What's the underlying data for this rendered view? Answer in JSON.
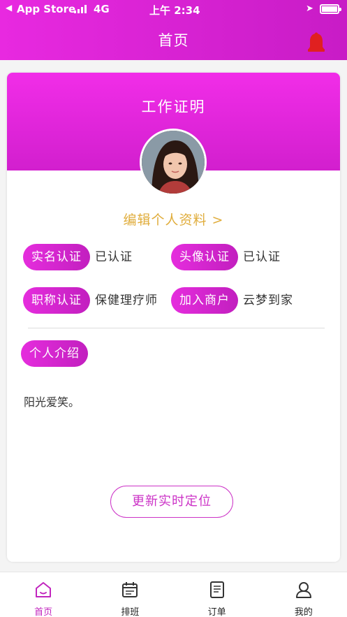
{
  "status_bar": {
    "back_label": "◀",
    "app_label": "App Store",
    "network": "4G",
    "time": "上午 2:34"
  },
  "header": {
    "title": "首页"
  },
  "card": {
    "title": "工作证明",
    "edit_link": "编辑个人资料 >",
    "items": [
      {
        "label": "实名认证",
        "value": "已认证"
      },
      {
        "label": "头像认证",
        "value": "已认证"
      },
      {
        "label": "职称认证",
        "value": "保健理疗师"
      },
      {
        "label": "加入商户",
        "value": "云梦到家"
      }
    ],
    "intro_label": "个人介绍",
    "intro_text": "阳光爱笑。",
    "update_button": "更新实时定位"
  },
  "tabbar": {
    "tabs": [
      {
        "label": "首页",
        "icon": "home-icon",
        "active": true
      },
      {
        "label": "排班",
        "icon": "calendar-icon",
        "active": false
      },
      {
        "label": "订单",
        "icon": "order-icon",
        "active": false
      },
      {
        "label": "我的",
        "icon": "user-icon",
        "active": false
      }
    ]
  },
  "colors": {
    "accent": "#d822d4",
    "edit_link": "#e0ad3c",
    "bell": "#e02020"
  }
}
